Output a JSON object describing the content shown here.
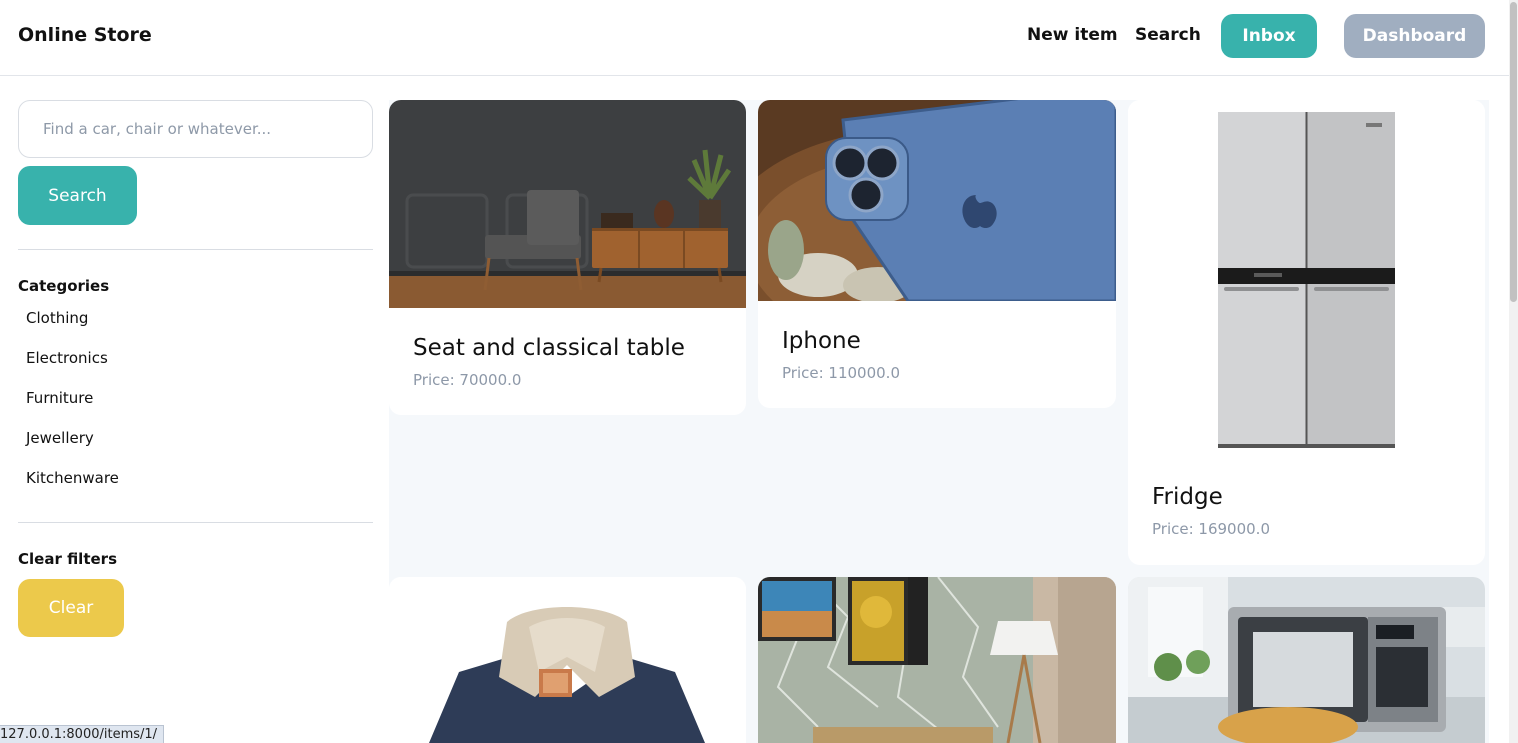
{
  "navbar": {
    "brand": "Online Store",
    "new_item": "New item",
    "search": "Search",
    "inbox": "Inbox",
    "dashboard": "Dashboard"
  },
  "sidebar": {
    "search_placeholder": "Find a car, chair or whatever...",
    "search_button": "Search",
    "categories_heading": "Categories",
    "categories": [
      "Clothing",
      "Electronics",
      "Furniture",
      "Jewellery",
      "Kitchenware"
    ],
    "clear_heading": "Clear filters",
    "clear_button": "Clear"
  },
  "items": [
    {
      "name": "Seat and classical table",
      "price": "Price: 70000.0",
      "image": "furniture-photo-icon"
    },
    {
      "name": "Iphone",
      "price": "Price: 110000.0",
      "image": "phone-photo-icon"
    },
    {
      "name": "Fridge",
      "price": "Price: 169000.0",
      "image": "fridge-photo-icon"
    },
    {
      "name": "",
      "price": "",
      "image": "jacket-photo-icon"
    },
    {
      "name": "",
      "price": "",
      "image": "living-room-photo-icon"
    },
    {
      "name": "",
      "price": "",
      "image": "microwave-photo-icon"
    }
  ],
  "status_bar": {
    "url": "127.0.0.1:8000/items/1/"
  },
  "colors": {
    "accent_teal": "#38b2ac",
    "dashboard_gray": "#a0aec0",
    "clear_yellow": "#ecc94b",
    "grid_background": "#f5f8fb",
    "price_gray": "#8d98a8"
  }
}
